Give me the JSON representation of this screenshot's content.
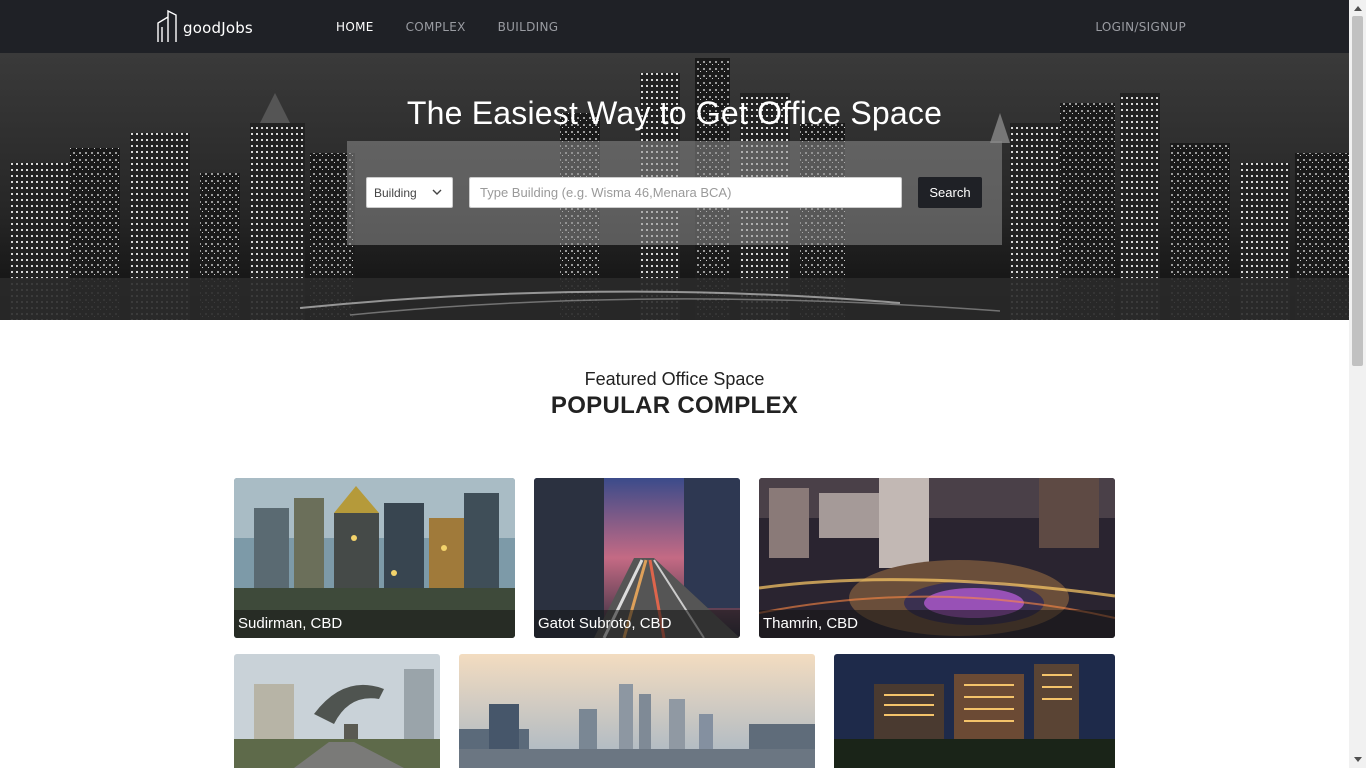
{
  "navbar": {
    "brand": "goodJobs",
    "links": [
      {
        "label": "HOME",
        "active": true
      },
      {
        "label": "COMPLEX",
        "active": false
      },
      {
        "label": "BUILDING",
        "active": false
      }
    ],
    "login_label": "LOGIN/SIGNUP"
  },
  "hero": {
    "title": "The Easiest Way to Get Office Space",
    "select_value": "Building",
    "search_placeholder": "Type Building (e.g. Wisma 46,Menara BCA)",
    "search_button": "Search"
  },
  "featured": {
    "subtitle": "Featured Office Space",
    "title": "POPULAR COMPLEX"
  },
  "cards": [
    {
      "label": "Sudirman, CBD"
    },
    {
      "label": "Gatot Subroto, CBD"
    },
    {
      "label": "Thamrin, CBD"
    },
    {
      "label": ""
    },
    {
      "label": ""
    },
    {
      "label": ""
    }
  ],
  "colors": {
    "navbar": "#1f2126",
    "accent_button": "#1f2126",
    "text_dark": "#222222"
  }
}
